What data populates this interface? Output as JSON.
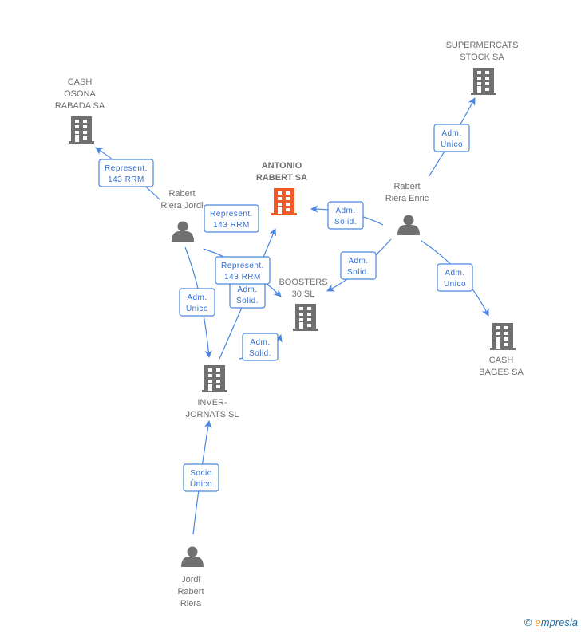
{
  "colors": {
    "edge": "#4a86e0",
    "node": "#707070",
    "focus": "#f05a28"
  },
  "nodes": [
    {
      "id": "cash_osona",
      "type": "company",
      "label": [
        "CASH",
        "OSONA",
        "RABADA SA"
      ],
      "icon": "building-icon"
    },
    {
      "id": "supermercats",
      "type": "company",
      "label": [
        "SUPERMERCATS",
        "STOCK SA"
      ],
      "icon": "building-icon"
    },
    {
      "id": "antonio",
      "type": "company",
      "focus": true,
      "label": [
        "ANTONIO",
        "RABERT SA"
      ],
      "icon": "building-icon"
    },
    {
      "id": "rabert_jordi",
      "type": "person",
      "label": [
        "Rabert",
        "Riera Jordi"
      ],
      "icon": "person-icon"
    },
    {
      "id": "rabert_enric",
      "type": "person",
      "label": [
        "Rabert",
        "Riera Enric"
      ],
      "icon": "person-icon"
    },
    {
      "id": "boosters",
      "type": "company",
      "label": [
        "BOOSTERS",
        "30  SL"
      ],
      "icon": "building-icon"
    },
    {
      "id": "cash_bages",
      "type": "company",
      "label": [
        "CASH",
        "BAGES SA"
      ],
      "icon": "building-icon"
    },
    {
      "id": "inver",
      "type": "company",
      "label": [
        "INVER-",
        "JORNATS  SL"
      ],
      "icon": "building-icon"
    },
    {
      "id": "jordi",
      "type": "person",
      "label": [
        "Jordi",
        "Rabert",
        "Riera"
      ],
      "icon": "person-icon"
    }
  ],
  "edges": [
    {
      "from": "rabert_jordi",
      "to": "cash_osona",
      "label": [
        "Represent.",
        "143 RRM"
      ]
    },
    {
      "from": "rabert_jordi",
      "to": "antonio",
      "label": [
        "Represent.",
        "143 RRM"
      ]
    },
    {
      "from": "inver",
      "to": "antonio",
      "label": [
        "Adm.",
        "Solid."
      ]
    },
    {
      "from": "rabert_jordi",
      "to": "boosters",
      "label": [
        "Represent.",
        "143 RRM"
      ]
    },
    {
      "from": "rabert_jordi",
      "to": "inver",
      "label": [
        "Adm.",
        "Unico"
      ]
    },
    {
      "from": "rabert_enric",
      "to": "antonio",
      "label": [
        "Adm.",
        "Solid."
      ]
    },
    {
      "from": "rabert_enric",
      "to": "boosters",
      "label": [
        "Adm.",
        "Solid."
      ]
    },
    {
      "from": "rabert_enric",
      "to": "supermercats",
      "label": [
        "Adm.",
        "Unico"
      ]
    },
    {
      "from": "rabert_enric",
      "to": "cash_bages",
      "label": [
        "Adm.",
        "Unico"
      ]
    },
    {
      "from": "inver",
      "to": "boosters",
      "label": [
        "Adm.",
        "Solid."
      ]
    },
    {
      "from": "jordi",
      "to": "inver",
      "label": [
        "Socio",
        "Único"
      ]
    }
  ],
  "brand": {
    "copyright": "©",
    "e": "e",
    "rest": "mpresia"
  }
}
